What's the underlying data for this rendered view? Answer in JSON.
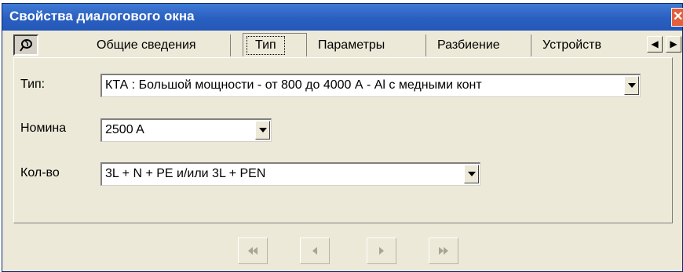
{
  "window": {
    "title": "Свойства диалогового окна",
    "close_glyph": "✕"
  },
  "tabs": [
    {
      "label": "Общие сведения",
      "active": false
    },
    {
      "label": "Тип",
      "active": true
    },
    {
      "label": "Параметры",
      "active": false
    },
    {
      "label": "Разбиение",
      "active": false
    },
    {
      "label": "Устройств",
      "active": false
    }
  ],
  "icons": {
    "pin": "pin-icon",
    "scroll_left": "◀",
    "scroll_right": "▶"
  },
  "fields": {
    "type": {
      "label": "Тип:",
      "value": "КТА : Большой мощности - от 800 до 4000 А - Al с медными конт"
    },
    "rating": {
      "label": "Номина",
      "value": "2500 A"
    },
    "count": {
      "label": "Кол-во",
      "value": "3L + N + PE и/или 3L + PEN"
    }
  },
  "navigation": {
    "first": "first-record-icon",
    "prev": "previous-record-icon",
    "next": "next-record-icon",
    "last": "last-record-icon",
    "enabled": false
  },
  "colors": {
    "titlebar": "#2a5fc0",
    "dialog_bg": "#ece9d8",
    "close": "#e2603c",
    "disabled_glyph": "#a8a49a"
  }
}
